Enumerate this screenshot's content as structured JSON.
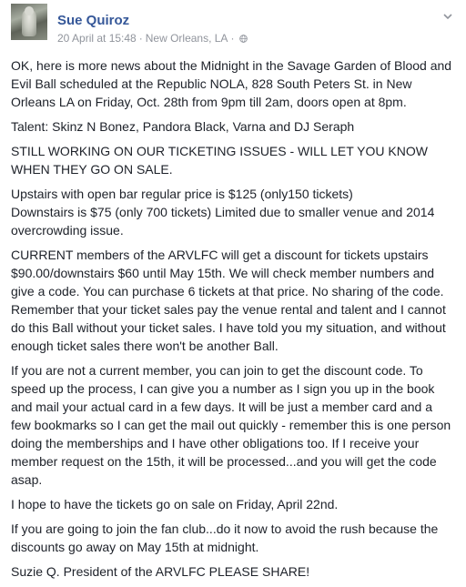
{
  "post": {
    "author": "Sue Quiroz",
    "date": "20 April at 15:48",
    "separator": "·",
    "location": "New Orleans, LA",
    "separator2": "·",
    "paragraphs": [
      [
        "OK, here is more news about the Midnight in the Savage Garden of Blood and",
        "Evil Ball scheduled at the Republic NOLA, 828 South Peters St. in New",
        "Orleans LA on Friday, Oct. 28th from 9pm till 2am, doors open at 8pm."
      ],
      [
        "Talent: Skinz N Bonez, Pandora Black, Varna and DJ Seraph"
      ],
      [
        "STILL WORKING ON OUR TICKETING ISSUES - WILL LET YOU KNOW",
        "WHEN THEY GO ON SALE."
      ],
      [
        "Upstairs with open bar regular price is $125 (only150 tickets)",
        "Downstairs is $75 (only 700 tickets) Limited due to smaller venue and 2014",
        "overcrowding issue."
      ],
      [
        "CURRENT members of the ARVLFC will get a discount for tickets upstairs",
        "$90.00/downstairs $60 until May 15th. We will check member numbers and",
        "give a code. You can purchase 6 tickets at that price. No sharing of the code.",
        "Remember that your ticket sales pay the venue rental and talent and I cannot",
        "do this Ball without your ticket sales. I have told you my situation, and without",
        "enough ticket sales there won't be another Ball."
      ],
      [
        "If you are not a current member, you can join to get the discount code. To",
        "speed up the process, I can give you a number as I sign you up in the book",
        "and mail your actual card in a few days. It will be just a member card and a",
        "few bookmarks so I can get the mail out quickly - remember this is one person",
        "doing the memberships and I have other obligations too. If I receive your",
        "member request on the 15th, it will be processed...and you will get the code",
        "asap."
      ],
      [
        "I hope to have the tickets go on sale on Friday, April 22nd."
      ],
      [
        "If you are going to join the fan club...do it now to avoid the rush because the",
        "discounts go away on May 15th at midnight."
      ],
      [
        "Suzie Q. President of the ARVLFC PLEASE SHARE!"
      ]
    ]
  },
  "icons": {
    "avatar": "statue-photo",
    "privacy": "globe-icon",
    "options": "chevron-down-icon"
  },
  "colors": {
    "author": "#365899",
    "meta": "#90949c",
    "text": "#1d2129"
  }
}
